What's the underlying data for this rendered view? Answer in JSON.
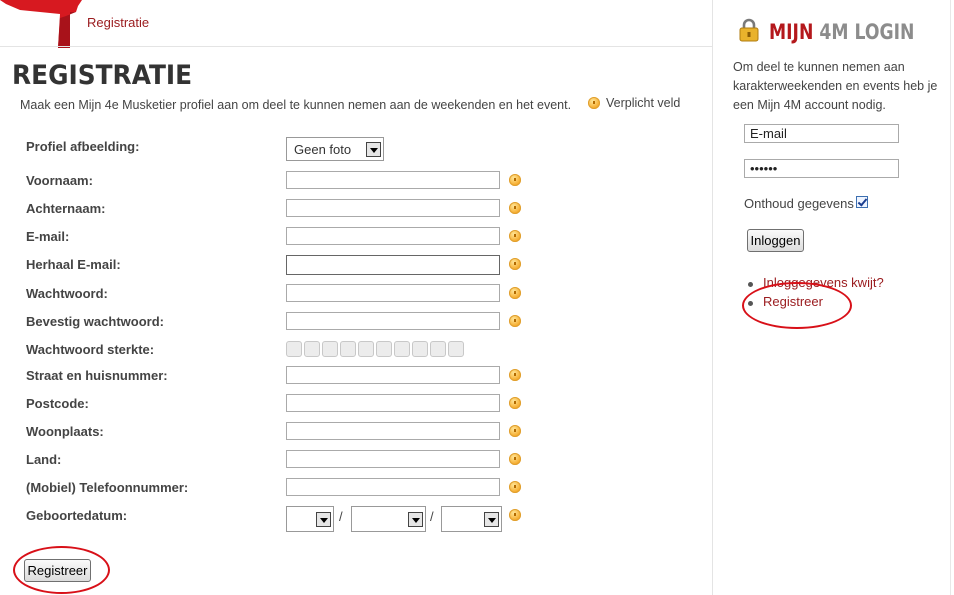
{
  "breadcrumb": "Registratie",
  "page_title": "REGISTRATIE",
  "intro_text": "Maak een Mijn 4e Musketier profiel aan om deel te kunnen nemen aan de weekenden en het event.",
  "required_note": "Verplicht veld",
  "form": {
    "profile_image_label": "Profiel afbeelding:",
    "profile_image_value": "Geen foto",
    "fields": [
      {
        "label": "Voornaam:"
      },
      {
        "label": "Achternaam:"
      },
      {
        "label": "E-mail:"
      },
      {
        "label": "Herhaal E-mail:"
      },
      {
        "label": "Wachtwoord:"
      },
      {
        "label": "Bevestig wachtwoord:"
      },
      {
        "label": "Wachtwoord sterkte:"
      },
      {
        "label": "Straat en huisnummer:"
      },
      {
        "label": "Postcode:"
      },
      {
        "label": "Woonplaats:"
      },
      {
        "label": "Land:"
      },
      {
        "label": "(Mobiel) Telefoonnummer:"
      },
      {
        "label": "Geboortedatum:"
      }
    ],
    "date_separator": "/",
    "submit_label": "Registreer"
  },
  "sidebar": {
    "title_part1": "MIJN",
    "title_part2": "4M LOGIN",
    "intro": "Om deel te kunnen nemen aan karakterweekenden en events heb je een Mijn 4M account nodig.",
    "email_placeholder": "E-mail",
    "password_value": "••••••",
    "remember_label": "Onthoud gegevens",
    "remember_checked": true,
    "login_label": "Inloggen",
    "links": [
      "Inloggegevens kwijt?",
      "Registreer"
    ]
  },
  "colors": {
    "brand_red": "#b4181c",
    "link_red": "#9b1d20",
    "annotation_red": "#d81018",
    "required_icon": "#f5a623"
  }
}
